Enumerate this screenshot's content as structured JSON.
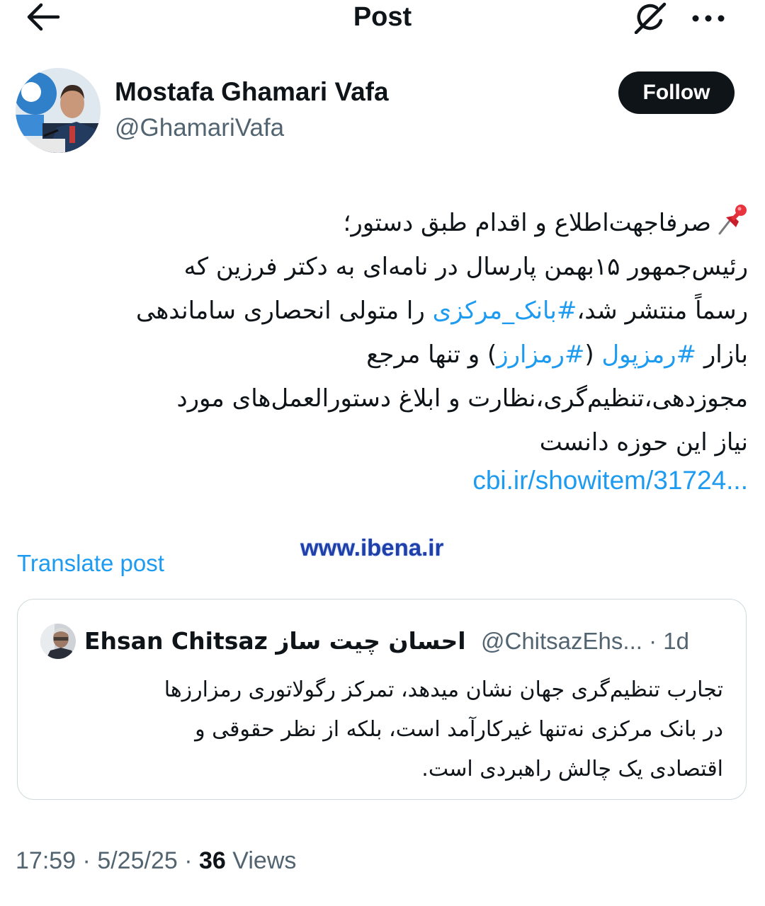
{
  "header": {
    "title": "Post",
    "back_icon": "arrow-left-icon",
    "grok_icon": "grok-icon",
    "more_icon": "more-horizontal-icon"
  },
  "author": {
    "name": "Mostafa Ghamari Vafa",
    "handle": "@GhamariVafa",
    "follow_label": "Follow"
  },
  "post": {
    "lines": [
      {
        "parts": [
          {
            "text": "صرفاجهت‌اطلاع و اقدام طبق دستور؛"
          }
        ]
      },
      {
        "parts": [
          {
            "text": "رئیس‌جمهور ۱۵بهمن پارسال در نامه‌ای به دکتر فرزین که"
          }
        ]
      },
      {
        "parts": [
          {
            "text": "رسماً منتشر شد،"
          },
          {
            "text": "#بانک_مرکزی",
            "tag": true
          },
          {
            "text": " را متولی انحصاری ساماندهی"
          }
        ]
      },
      {
        "parts": [
          {
            "text": "بازار "
          },
          {
            "text": "#رمزپول",
            "tag": true
          },
          {
            "text": " ("
          },
          {
            "text": "#رمزارز",
            "tag": true
          },
          {
            "text": ") و تنها مرجع"
          }
        ]
      },
      {
        "parts": [
          {
            "text": "مجوزدهی،تنظیم‌گری،نظارت و ابلاغ دستورالعمل‌های مورد"
          }
        ]
      },
      {
        "parts": [
          {
            "text": "نیاز این حوزه دانست"
          }
        ]
      }
    ],
    "link": "cbi.ir/showitem/31724...",
    "pin_icon": "pushpin-icon",
    "watermark": "www.ibena.ir",
    "translate_label": "Translate post"
  },
  "quote": {
    "name": "Ehsan Chitsaz احسان چیت ساز",
    "meta": "@ChitsazEhs... · 1d",
    "lines": [
      "تجارب تنظیم‌گری جهان نشان میدهد، تمرکز رگولاتوری رمزارزها",
      "در بانک مرکزی نه‌تنها غیرکارآمد است، بلکه از نظر حقوقی و",
      "اقتصادی یک چالش راهبردی است."
    ]
  },
  "footer": {
    "time": "17:59",
    "date": "5/25/25",
    "views_count": "36",
    "views_label": "Views"
  },
  "colors": {
    "text": "#0f1419",
    "secondary": "#536471",
    "accent": "#1d9bf0",
    "border": "#cfd9de",
    "follow_bg": "#0f1419"
  }
}
